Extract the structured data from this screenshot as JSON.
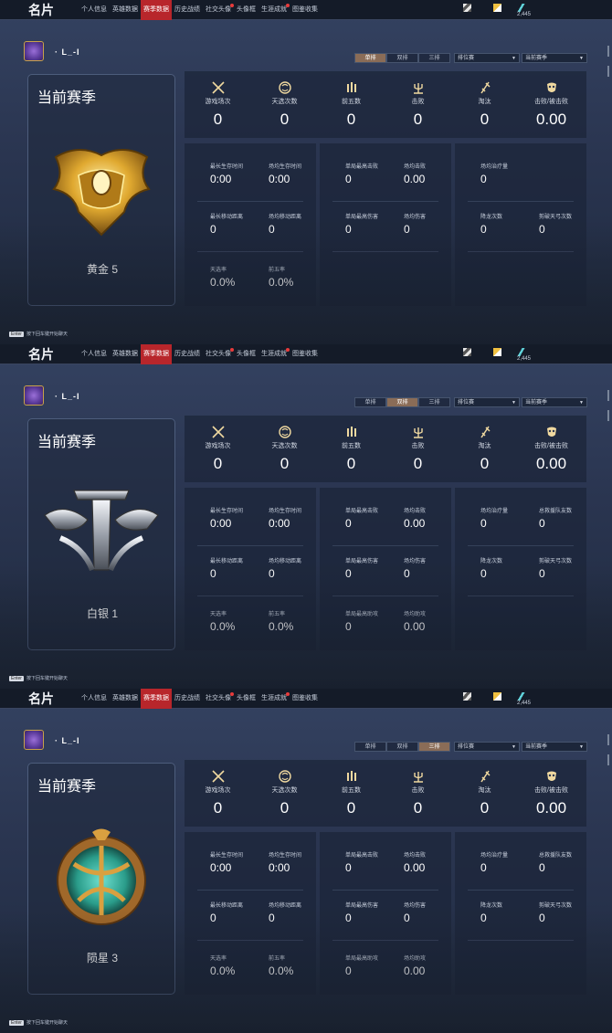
{
  "nav": {
    "brand": "名片",
    "tabs": [
      {
        "label": "个人信息",
        "active": false,
        "dot": false
      },
      {
        "label": "英雄数据",
        "active": false,
        "dot": false
      },
      {
        "label": "赛季数据",
        "active": true,
        "dot": false
      },
      {
        "label": "历史战绩",
        "active": false,
        "dot": false
      },
      {
        "label": "社交头像",
        "active": false,
        "dot": true
      },
      {
        "label": "头像框",
        "active": false,
        "dot": false
      },
      {
        "label": "生涯成就",
        "active": false,
        "dot": true
      },
      {
        "label": "图鉴收集",
        "active": false,
        "dot": false
      }
    ],
    "currency": "2,445"
  },
  "player": {
    "name": "· L_-I"
  },
  "modes": [
    "单排",
    "双排",
    "三排"
  ],
  "dropdowns": {
    "mode_filter": "排位赛",
    "season": "当前赛季"
  },
  "hint": {
    "key": "Enter",
    "text": "按下回车键开始聊天"
  },
  "stat_labels": [
    "游戏场次",
    "天选次数",
    "前五数",
    "击败",
    "淘汰",
    "击败/被击败"
  ],
  "colors": {
    "active_tab": "#b8262b",
    "selected_mode": "#8a6c57",
    "gold": "#d9a93a",
    "silver": "#c9ccd2",
    "jade": "#3bb3a0"
  },
  "panels": [
    {
      "selected_mode": 0,
      "card_title": "当前赛季",
      "rank_name": "黄金 5",
      "emblem": "gold-rank-emblem",
      "top_values": [
        "0",
        "0",
        "0",
        "0",
        "0",
        "0.00"
      ],
      "box1": [
        {
          "label": "最长生存时间",
          "value": "0:00"
        },
        {
          "label": "场均生存时间",
          "value": "0:00"
        },
        {
          "label": "最长移动距离",
          "value": "0"
        },
        {
          "label": "场均移动距离",
          "value": "0"
        },
        {
          "label": "天选率",
          "value": "0.0%"
        },
        {
          "label": "前五率",
          "value": "0.0%"
        }
      ],
      "box2": [
        {
          "label": "单局最高击败",
          "value": "0"
        },
        {
          "label": "场均击败",
          "value": "0.00"
        },
        {
          "label": "单局最高伤害",
          "value": "0"
        },
        {
          "label": "场均伤害",
          "value": "0"
        }
      ],
      "box3": [
        {
          "label": "场均治疗量",
          "value": "0"
        },
        {
          "label": "降龙次数",
          "value": "0"
        },
        {
          "label": "剪破天弓次数",
          "value": "0"
        }
      ]
    },
    {
      "selected_mode": 1,
      "card_title": "当前赛季",
      "rank_name": "白银 1",
      "emblem": "silver-rank-emblem",
      "top_values": [
        "0",
        "0",
        "0",
        "0",
        "0",
        "0.00"
      ],
      "box1": [
        {
          "label": "最长生存时间",
          "value": "0:00"
        },
        {
          "label": "场均生存时间",
          "value": "0:00"
        },
        {
          "label": "最长移动距离",
          "value": "0"
        },
        {
          "label": "场均移动距离",
          "value": "0"
        },
        {
          "label": "天选率",
          "value": "0.0%"
        },
        {
          "label": "前五率",
          "value": "0.0%"
        }
      ],
      "box2": [
        {
          "label": "单局最高击败",
          "value": "0"
        },
        {
          "label": "场均击败",
          "value": "0.00"
        },
        {
          "label": "单局最高伤害",
          "value": "0"
        },
        {
          "label": "场均伤害",
          "value": "0"
        },
        {
          "label": "单局最高助攻",
          "value": "0"
        },
        {
          "label": "场均助攻",
          "value": "0.00"
        }
      ],
      "box3": [
        {
          "label": "场均治疗量",
          "value": "0"
        },
        {
          "label": "总救援队友数",
          "value": "0"
        },
        {
          "label": "降龙次数",
          "value": "0"
        },
        {
          "label": "剪破天弓次数",
          "value": "0"
        }
      ]
    },
    {
      "selected_mode": 2,
      "card_title": "当前赛季",
      "rank_name": "陨星 3",
      "emblem": "meteor-rank-emblem",
      "top_values": [
        "0",
        "0",
        "0",
        "0",
        "0",
        "0.00"
      ],
      "box1": [
        {
          "label": "最长生存时间",
          "value": "0:00"
        },
        {
          "label": "场均生存时间",
          "value": "0:00"
        },
        {
          "label": "最长移动距离",
          "value": "0"
        },
        {
          "label": "场均移动距离",
          "value": "0"
        },
        {
          "label": "天选率",
          "value": "0.0%"
        },
        {
          "label": "前五率",
          "value": "0.0%"
        }
      ],
      "box2": [
        {
          "label": "单局最高击败",
          "value": "0"
        },
        {
          "label": "场均击败",
          "value": "0.00"
        },
        {
          "label": "单局最高伤害",
          "value": "0"
        },
        {
          "label": "场均伤害",
          "value": "0"
        },
        {
          "label": "单局最高助攻",
          "value": "0"
        },
        {
          "label": "场均助攻",
          "value": "0.00"
        }
      ],
      "box3": [
        {
          "label": "场均治疗量",
          "value": "0"
        },
        {
          "label": "总救援队友数",
          "value": "0"
        },
        {
          "label": "降龙次数",
          "value": "0"
        },
        {
          "label": "剪破天弓次数",
          "value": "0"
        }
      ]
    }
  ]
}
